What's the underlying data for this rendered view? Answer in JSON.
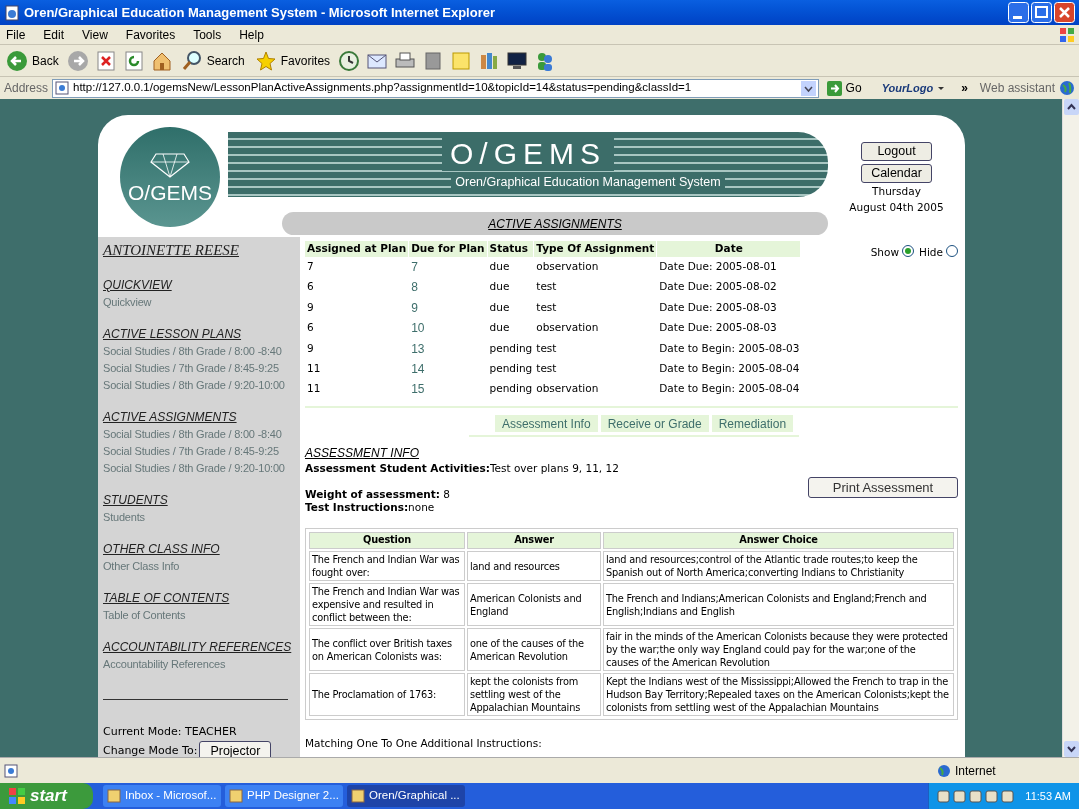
{
  "window": {
    "title": "Oren/Graphical Education Management System - Microsoft Internet Explorer"
  },
  "menu_bar": [
    "File",
    "Edit",
    "View",
    "Favorites",
    "Tools",
    "Help"
  ],
  "toolbar": [
    {
      "kind": "back",
      "label": "Back"
    },
    {
      "kind": "forward"
    },
    {
      "kind": "stop"
    },
    {
      "kind": "refresh"
    },
    {
      "kind": "home"
    },
    {
      "kind": "search",
      "label": "Search"
    },
    {
      "kind": "favorites",
      "label": "Favorites"
    },
    {
      "kind": "history"
    },
    {
      "kind": "mail"
    },
    {
      "kind": "print"
    },
    {
      "kind": "edit"
    },
    {
      "kind": "note"
    },
    {
      "kind": "research"
    },
    {
      "kind": "monitor"
    },
    {
      "kind": "messenger"
    }
  ],
  "address_bar": {
    "label": "Address",
    "url": "http://127.0.0.1/ogemsNew/LessonPlanActiveAssignments.php?assignmentId=10&topicId=14&status=pending&classId=1",
    "go": "Go",
    "logo": "YourLogo",
    "more": "»",
    "assistant": "Web assistant"
  },
  "header": {
    "logo_text": "O/GEMS",
    "banner_title": "O/GEMS",
    "banner_subtitle": "Oren/Graphical Education Management System",
    "buttons": [
      "Logout",
      "Calendar"
    ],
    "day": "Thursday",
    "date": "August 04th 2005",
    "section_title": "ACTIVE ASSIGNMENTS"
  },
  "sidebar": {
    "user_name": "ANTOINETTE REESE",
    "sections": [
      {
        "heading": "QUICKVIEW",
        "links": [
          "Quickview"
        ]
      },
      {
        "heading": "ACTIVE LESSON PLANS",
        "links": [
          "Social Studies / 8th Grade / 8:00 -8:40",
          "Social Studies / 7th Grade / 8:45-9:25",
          "Social Studies / 8th Grade / 9:20-10:00"
        ]
      },
      {
        "heading": "ACTIVE ASSIGNMENTS",
        "links": [
          "Social Studies / 8th Grade / 8:00 -8:40",
          "Social Studies / 7th Grade / 8:45-9:25",
          "Social Studies / 8th Grade / 9:20-10:00"
        ]
      },
      {
        "heading": "STUDENTS",
        "links": [
          "Students"
        ]
      },
      {
        "heading": "OTHER CLASS INFO",
        "links": [
          "Other Class Info"
        ]
      },
      {
        "heading": "TABLE OF CONTENTS",
        "links": [
          "Table of Contents"
        ]
      },
      {
        "heading": "ACCOUNTABILITY REFERENCES",
        "links": [
          "Accountability References"
        ]
      }
    ],
    "current_mode": "Current Mode: TEACHER",
    "change_mode_label": "Change Mode To:",
    "change_mode_button": "Projector"
  },
  "assignments": {
    "columns": [
      "Assigned at Plan",
      "Due for Plan",
      "Status",
      "Type Of Assignment",
      "Date"
    ],
    "rows": [
      [
        "7",
        "7",
        "due",
        "observation",
        "Date Due: 2005-08-01"
      ],
      [
        "6",
        "8",
        "due",
        "test",
        "Date Due: 2005-08-02"
      ],
      [
        "9",
        "9",
        "due",
        "test",
        "Date Due: 2005-08-03"
      ],
      [
        "6",
        "10",
        "due",
        "observation",
        "Date Due: 2005-08-03"
      ],
      [
        "9",
        "13",
        "pending",
        "test",
        "Date to Begin: 2005-08-03"
      ],
      [
        "11",
        "14",
        "pending",
        "test",
        "Date to Begin: 2005-08-04"
      ],
      [
        "11",
        "15",
        "pending",
        "observation",
        "Date to Begin: 2005-08-04"
      ]
    ],
    "visibility": [
      {
        "label": "Show",
        "selected": true
      },
      {
        "label": "Hide",
        "selected": false
      }
    ]
  },
  "subtabs": [
    "Assessment Info",
    "Receive or Grade",
    "Remediation"
  ],
  "assessment_info": {
    "heading": "ASSESSMENT INFO",
    "activities_label": "Assessment Student Activities:",
    "activities": "Test over plans 9, 11, 12",
    "weight_label": "Weight of assessment:",
    "weight": "8",
    "instructions_label": "Test Instructions:",
    "instructions": "none",
    "print_button": "Print Assessment",
    "questions": {
      "columns": [
        "Question",
        "Answer",
        "Answer Choice"
      ],
      "rows": [
        [
          "The French and Indian War was fought over:",
          "land and resources",
          "land and resources;control of the Atlantic trade routes;to keep the Spanish out of North America;converting Indians to Christianity"
        ],
        [
          "The French and Indian War was expensive and resulted in conflict between the:",
          "American Colonists and England",
          "The French and Indians;American Colonists and England;French and English;Indians and English"
        ],
        [
          "The conflict over British taxes on American Colonists was:",
          "one of the causes of the American Revolution",
          "fair in the minds of the American Colonists because they were protected by the war;the only way England could pay for the war;one of the causes of the American Revolution"
        ],
        [
          "The Proclamation of 1763:",
          "kept the colonists from settling west of the Appalachian Mountains",
          "Kept the Indians west of the Mississippi;Allowed the French to trap in the Hudson Bay Territory;Repealed taxes on the American Colonists;kept the colonists from settling west of the Appalachian Mountains"
        ]
      ]
    },
    "footer_text": "Matching One To One Additional Instructions:"
  },
  "status_bar": {
    "zone": "Internet"
  },
  "taskbar": {
    "start": "start",
    "tasks": [
      {
        "label": "Inbox - Microsof...",
        "selected": false
      },
      {
        "label": "PHP Designer 2...",
        "selected": false
      },
      {
        "label": "Oren/Graphical ...",
        "selected": true
      }
    ],
    "clock": "11:53 AM"
  }
}
